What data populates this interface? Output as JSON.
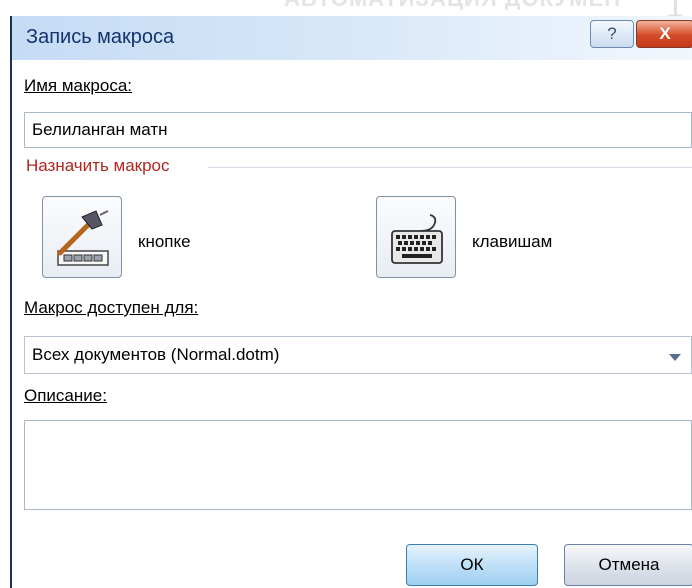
{
  "background_watermark": {
    "top_text": "АВТОМАТИЗАЦИЯ ДОКУМЕНТА",
    "number": "1"
  },
  "dialog": {
    "title": "Запись макроса",
    "help_glyph": "?",
    "close_glyph": "X",
    "macro_name_label": "Имя макроса:",
    "macro_name_value": "Белиланган матн",
    "assign_group_title": "Назначить макрос",
    "button_assign": {
      "label": "кнопке",
      "icon": "hammer-toolbar-icon"
    },
    "keyboard_assign": {
      "label": "клавишам",
      "icon": "keyboard-icon"
    },
    "available_for_label": "Макрос доступен для:",
    "available_for_value": "Всех документов (Normal.dotm)",
    "description_label": "Описание:",
    "description_value": "",
    "ok_label": "ОК",
    "cancel_label": "Отмена",
    "colors": {
      "title_text": "#14326e",
      "group_title": "#b3261e",
      "close_button": "#d44b28"
    }
  }
}
